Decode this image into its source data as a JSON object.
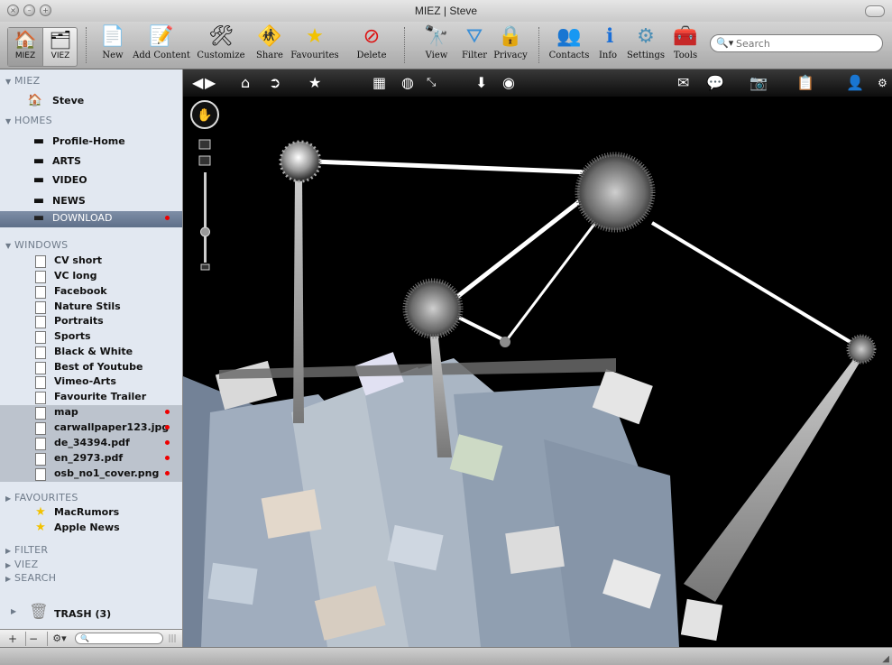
{
  "window": {
    "title": "MIEZ | Steve"
  },
  "toolbar": {
    "view_switch": [
      {
        "label": "MIEZ",
        "icon": "home-icon"
      },
      {
        "label": "VIEZ",
        "icon": "cubes-icon"
      }
    ],
    "buttons": [
      {
        "label": "New",
        "icon": "new-document-icon"
      },
      {
        "label": "Add Content",
        "icon": "add-content-icon"
      },
      {
        "label": "Customize",
        "icon": "tools-icon"
      },
      {
        "label": "Share",
        "icon": "share-icon"
      },
      {
        "label": "Favourites",
        "icon": "star-icon"
      },
      {
        "label": "Delete",
        "icon": "delete-icon"
      },
      {
        "label": "View",
        "icon": "binoculars-icon"
      },
      {
        "label": "Filter",
        "icon": "filter-icon"
      },
      {
        "label": "Privacy",
        "icon": "lock-icon"
      },
      {
        "label": "Contacts",
        "icon": "contacts-icon"
      },
      {
        "label": "Info",
        "icon": "info-icon"
      },
      {
        "label": "Settings",
        "icon": "gear-icon"
      },
      {
        "label": "Tools",
        "icon": "toolbox-icon"
      }
    ],
    "search_placeholder": "Search"
  },
  "sidebar": {
    "miez": {
      "header": "MIEZ",
      "items": [
        {
          "label": "Steve",
          "icon": "home-icon"
        }
      ]
    },
    "homes": {
      "header": "HOMES",
      "items": [
        {
          "label": "Profile-Home"
        },
        {
          "label": "ARTS"
        },
        {
          "label": "VIDEO"
        },
        {
          "label": "NEWS"
        },
        {
          "label": "DOWNLOAD",
          "selected": true,
          "badge": true
        }
      ]
    },
    "windows": {
      "header": "WINDOWS",
      "items": [
        {
          "label": "CV short"
        },
        {
          "label": "VC long"
        },
        {
          "label": "Facebook"
        },
        {
          "label": "Nature Stils"
        },
        {
          "label": "Portraits"
        },
        {
          "label": "Sports"
        },
        {
          "label": "Black & White"
        },
        {
          "label": "Best of Youtube"
        },
        {
          "label": "Vimeo-Arts"
        },
        {
          "label": "Favourite Trailer"
        },
        {
          "label": "map",
          "badge": true
        },
        {
          "label": "carwallpaper123.jpg",
          "badge": true
        },
        {
          "label": "de_34394.pdf",
          "badge": true
        },
        {
          "label": "en_2973.pdf",
          "badge": true
        },
        {
          "label": "osb_no1_cover.png",
          "badge": true
        }
      ]
    },
    "favourites": {
      "header": "FAVOURITES",
      "items": [
        {
          "label": "MacRumors",
          "icon": "star-icon"
        },
        {
          "label": "Apple News",
          "icon": "star-icon"
        }
      ]
    },
    "collapsed": [
      "FILTER",
      "VIEZ",
      "SEARCH"
    ],
    "trash": "TRASH (3)"
  },
  "colors": {
    "accent_selected": "#5e6f89",
    "badge": "#e00000",
    "sidebar_bg": "#e2e8f1",
    "canvas_bg": "#000000"
  }
}
